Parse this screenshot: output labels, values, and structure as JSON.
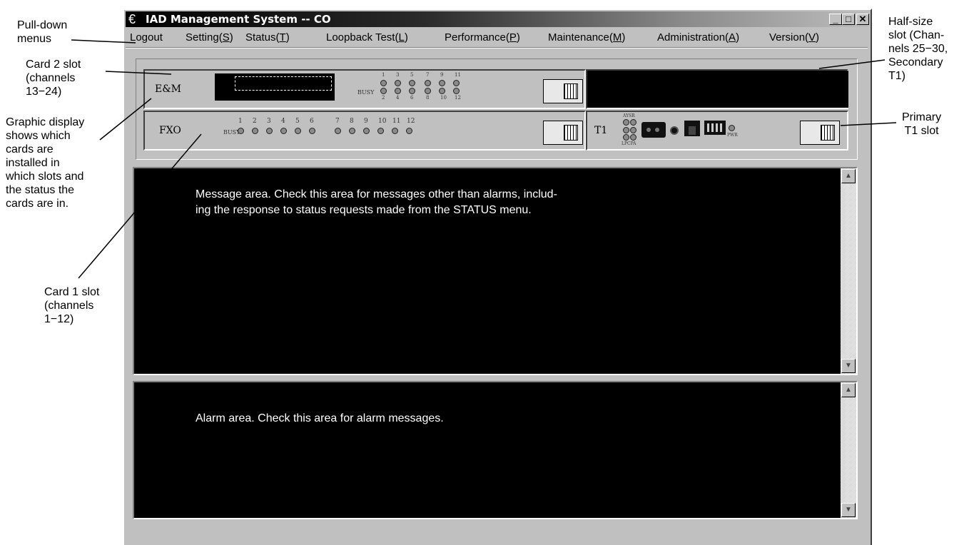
{
  "callouts": {
    "pulldown": "Pull-down\nmenus",
    "card2": "Card 2 slot\n(channels\n13−24)",
    "graphic": "Graphic display\nshows which\ncards are\ninstalled in\nwhich slots and\nthe status the\ncards are in.",
    "card1": "Card 1 slot\n(channels\n1−12)",
    "halfsize": "Half-size\nslot (Chan-\nnels 25−30,\nSecondary\nT1)",
    "primary": "Primary\nT1  slot"
  },
  "window": {
    "title": "IAD Management System -- CO",
    "app_icon": "app-icon",
    "controls": {
      "minimize": "_",
      "maximize": "□",
      "close": "✕"
    }
  },
  "menu": [
    {
      "text": "Logout",
      "hotkey": ""
    },
    {
      "text": "Setting(",
      "hotkey": "S",
      "after": ")"
    },
    {
      "text": "Status(",
      "hotkey": "T",
      "after": ")"
    },
    {
      "text": "Loopback Test(",
      "hotkey": "L",
      "after": ")"
    },
    {
      "text": "Performance(",
      "hotkey": "P",
      "after": ")"
    },
    {
      "text": "Maintenance(",
      "hotkey": "M",
      "after": ")"
    },
    {
      "text": "Administration(",
      "hotkey": "A",
      "after": ")"
    },
    {
      "text": "Version(",
      "hotkey": "V",
      "after": ")"
    }
  ],
  "cards": {
    "card2_name": "E&M",
    "card1_name": "FXO",
    "t1_name": "T1",
    "busy_label": "BUSY",
    "em_top_nums": [
      "1",
      "3",
      "5",
      "7",
      "9",
      "11"
    ],
    "em_bottom_nums": [
      "2",
      "4",
      "6",
      "8",
      "10",
      "12"
    ],
    "fxo_nums": [
      "1",
      "2",
      "3",
      "4",
      "5",
      "6",
      "7",
      "8",
      "9",
      "10",
      "11",
      "12"
    ],
    "t1_led_top": "AYSR",
    "t1_led_bottom": "LPCPA",
    "pwr": "PWR"
  },
  "message_area": {
    "text_line1": "Message area. Check this area for messages other than alarms, includ-",
    "text_line2": "ing the response to status requests made from the STATUS menu."
  },
  "alarm_area": {
    "text": "Alarm area. Check this area for alarm messages."
  },
  "scroll": {
    "up": "▲",
    "down": "▼"
  }
}
